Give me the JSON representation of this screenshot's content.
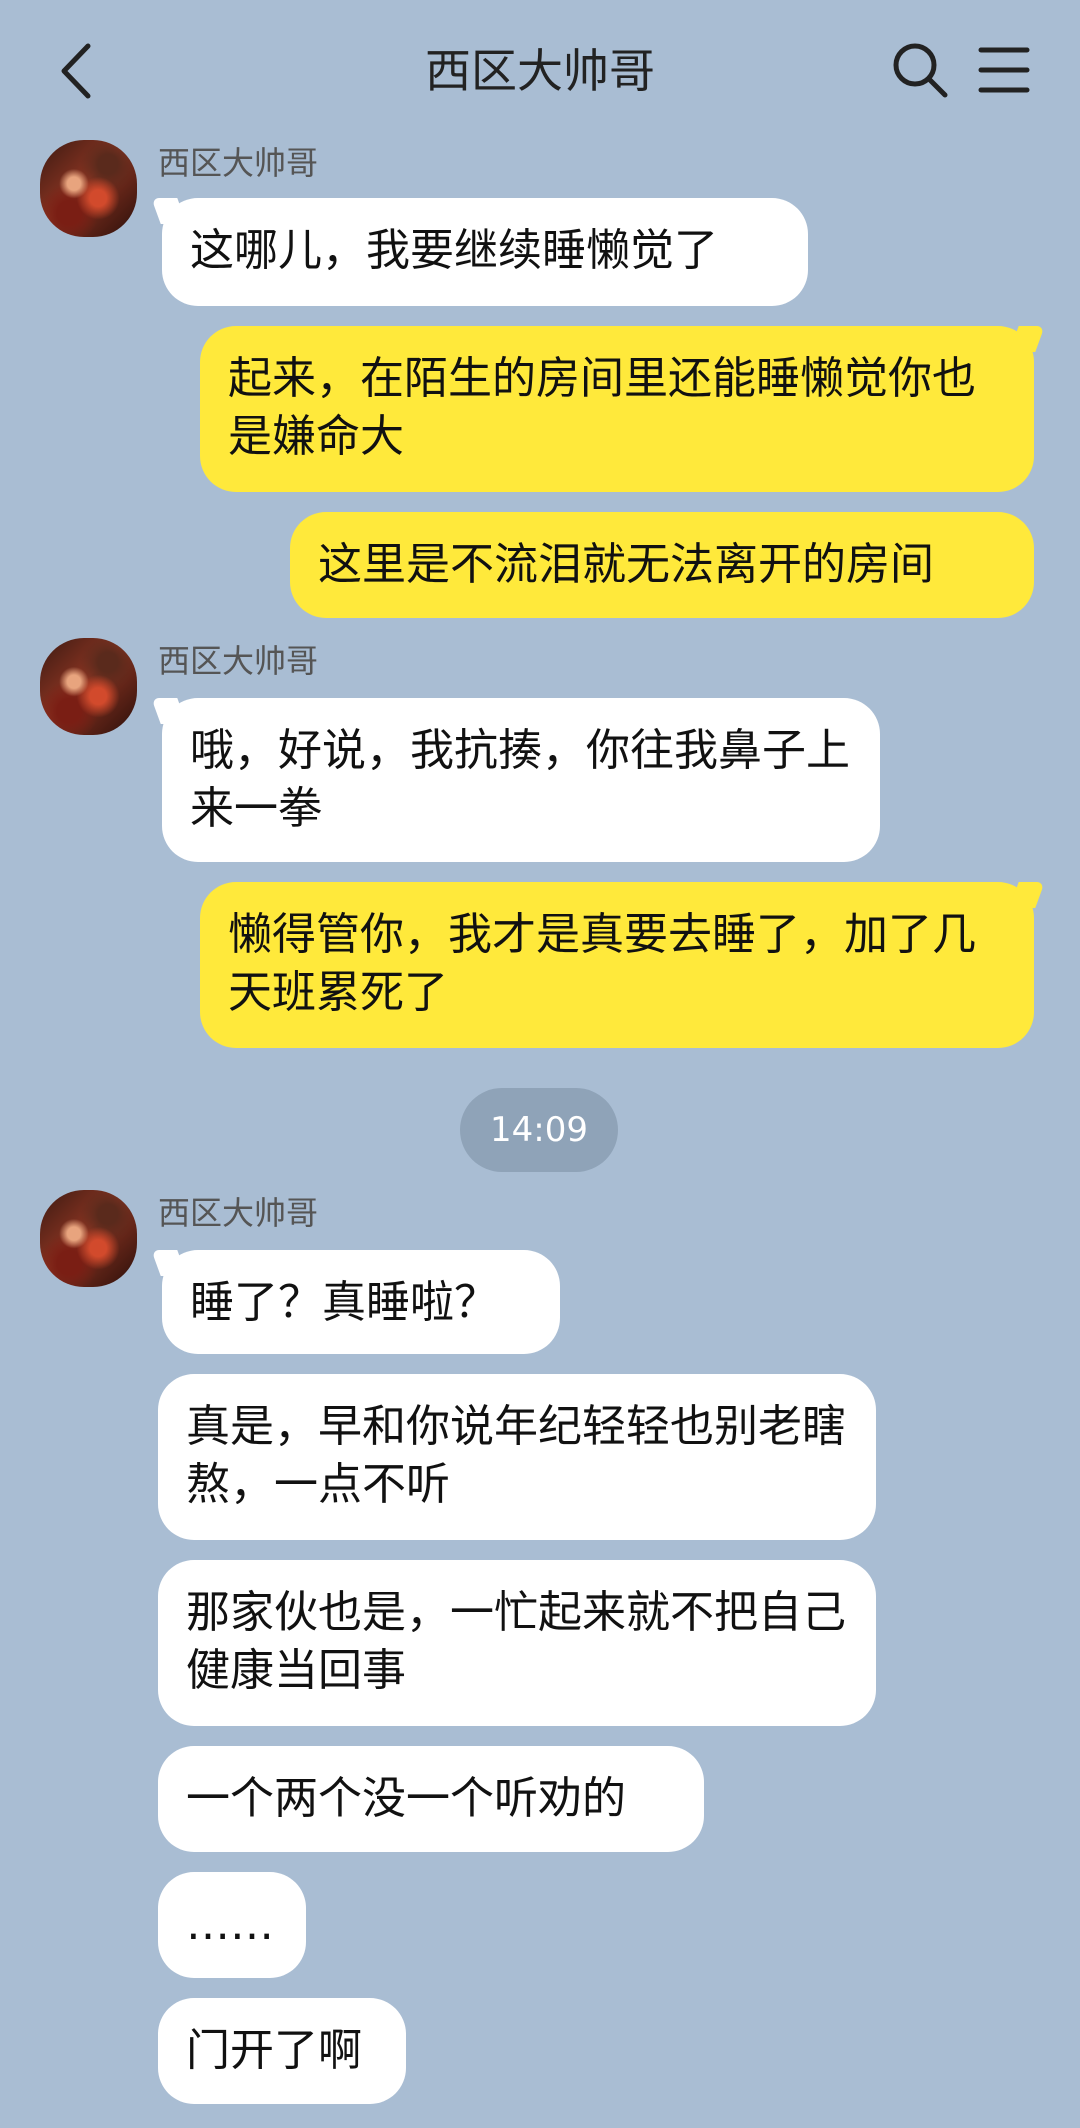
{
  "header": {
    "title": "西区大帅哥"
  },
  "time_divider": "14:09",
  "messages": [
    {
      "sender": "西区大帅哥",
      "text": "这哪儿，我要继续睡懒觉了"
    },
    {
      "text": "起来，在陌生的房间里还能睡懒觉你也是嫌命大"
    },
    {
      "text": "这里是不流泪就无法离开的房间"
    },
    {
      "sender": "西区大帅哥",
      "text": "哦，好说，我抗揍，你往我鼻子上来一拳"
    },
    {
      "text": "懒得管你，我才是真要去睡了，加了几天班累死了"
    },
    {
      "sender": "西区大帅哥",
      "text": "睡了？真睡啦？"
    },
    {
      "text": "真是，早和你说年纪轻轻也别老瞎熬，一点不听"
    },
    {
      "text": "那家伙也是，一忙起来就不把自己健康当回事"
    },
    {
      "text": "一个两个没一个听劝的"
    },
    {
      "text": "……"
    },
    {
      "text": "门开了啊"
    }
  ],
  "colors": {
    "background": "#a9bdd3",
    "incoming_bubble": "#ffffff",
    "outgoing_bubble": "#ffe93b",
    "time_pill": "#8fa3b8"
  },
  "icons": [
    "back-arrow-icon",
    "search-icon",
    "menu-icon"
  ]
}
